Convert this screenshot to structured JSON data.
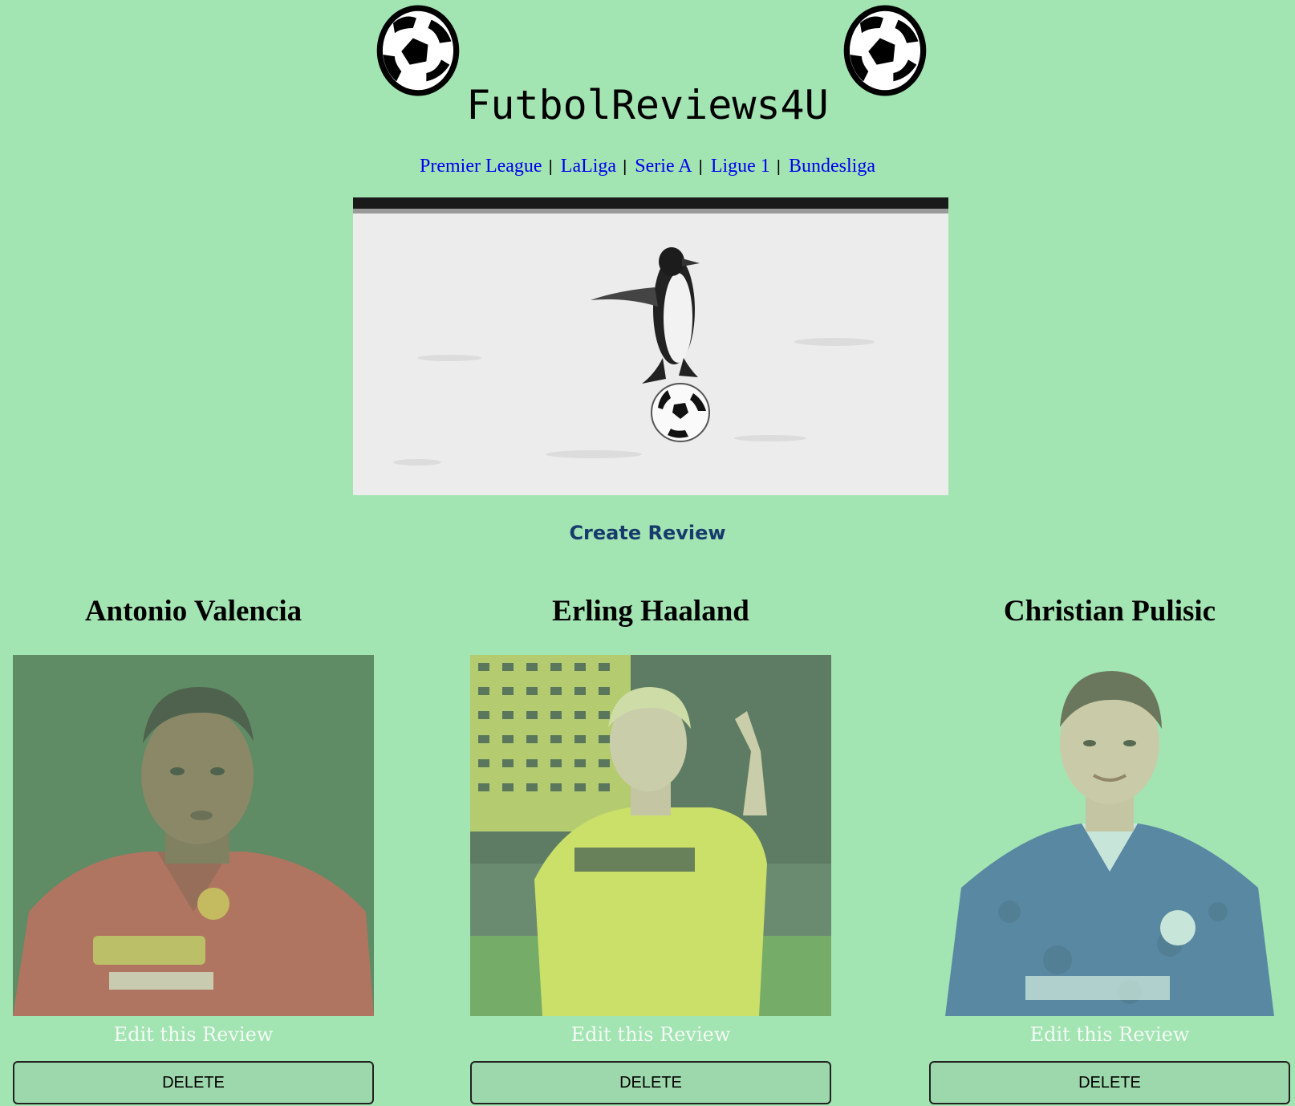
{
  "header": {
    "title": "FutbolReviews4U",
    "left_icon": "soccer-ball-icon",
    "right_icon": "soccer-ball-icon"
  },
  "nav": {
    "links": [
      "Premier League",
      "LaLiga",
      "Serie A",
      "Ligue 1",
      "Bundesliga"
    ],
    "separator": "|"
  },
  "hero": {
    "image": "penguin-on-soccer-ball-image"
  },
  "actions": {
    "create_review": "Create Review"
  },
  "reviews": [
    {
      "name": "Antonio Valencia",
      "photo": "antonio-valencia-photo",
      "edit_label": "Edit this Review",
      "delete_label": "DELETE"
    },
    {
      "name": "Erling Haaland",
      "photo": "erling-haaland-photo",
      "edit_label": "Edit this Review",
      "delete_label": "DELETE"
    },
    {
      "name": "Christian Pulisic",
      "photo": "christian-pulisic-photo",
      "edit_label": "Edit this Review",
      "delete_label": "DELETE"
    }
  ],
  "colors": {
    "background": "#a3e4b3",
    "nav_link": "#0000ee",
    "create_link": "#173b6c",
    "edit_link": "#f4fbf5"
  }
}
